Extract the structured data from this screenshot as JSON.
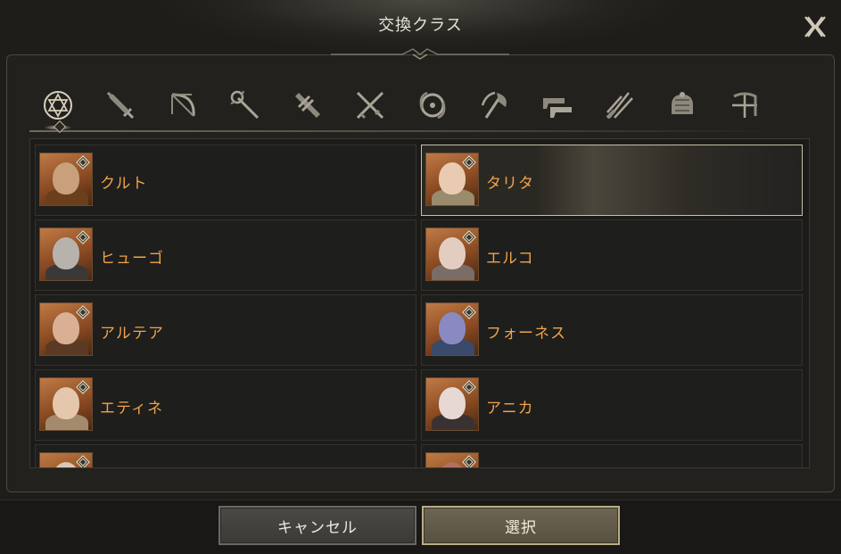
{
  "window": {
    "title": "交換クラス"
  },
  "tabs": [
    {
      "icon": "hexagram-icon",
      "active": true
    },
    {
      "icon": "sword-icon"
    },
    {
      "icon": "bow-icon"
    },
    {
      "icon": "staff-icon"
    },
    {
      "icon": "greatsword-icon"
    },
    {
      "icon": "dual-blades-icon"
    },
    {
      "icon": "orb-icon"
    },
    {
      "icon": "axe-icon"
    },
    {
      "icon": "crossed-guns-icon"
    },
    {
      "icon": "claw-blades-icon"
    },
    {
      "icon": "gauntlet-icon"
    },
    {
      "icon": "crossbow-icon"
    }
  ],
  "characters": [
    {
      "name": "クルト",
      "face": "#c9a07c",
      "body": "#6b3f1c"
    },
    {
      "name": "タリタ",
      "face": "#e8cbb0",
      "body": "#9a8b6c",
      "selected": true
    },
    {
      "name": "ヒューゴ",
      "face": "#b8b2ad",
      "body": "#3b3838"
    },
    {
      "name": "エルコ",
      "face": "#e2cdc0",
      "body": "#7a6d66"
    },
    {
      "name": "アルテア",
      "face": "#d9b094",
      "body": "#5a3a24"
    },
    {
      "name": "フォーネス",
      "face": "#8a8ac0",
      "body": "#3a4a6a"
    },
    {
      "name": "エティネ",
      "face": "#e4c7ad",
      "body": "#a48a6c"
    },
    {
      "name": "アニカ",
      "face": "#e6d8d2",
      "body": "#3a3232"
    },
    {
      "name": "",
      "face": "#d9c6b4",
      "body": "#8a6a50"
    },
    {
      "name": "",
      "face": "#b07060",
      "body": "#6a2a20"
    }
  ],
  "buttons": {
    "cancel": "キャンセル",
    "select": "選択"
  },
  "colors": {
    "name_text": "#f0a34a",
    "accent": "#c8c1a6"
  }
}
